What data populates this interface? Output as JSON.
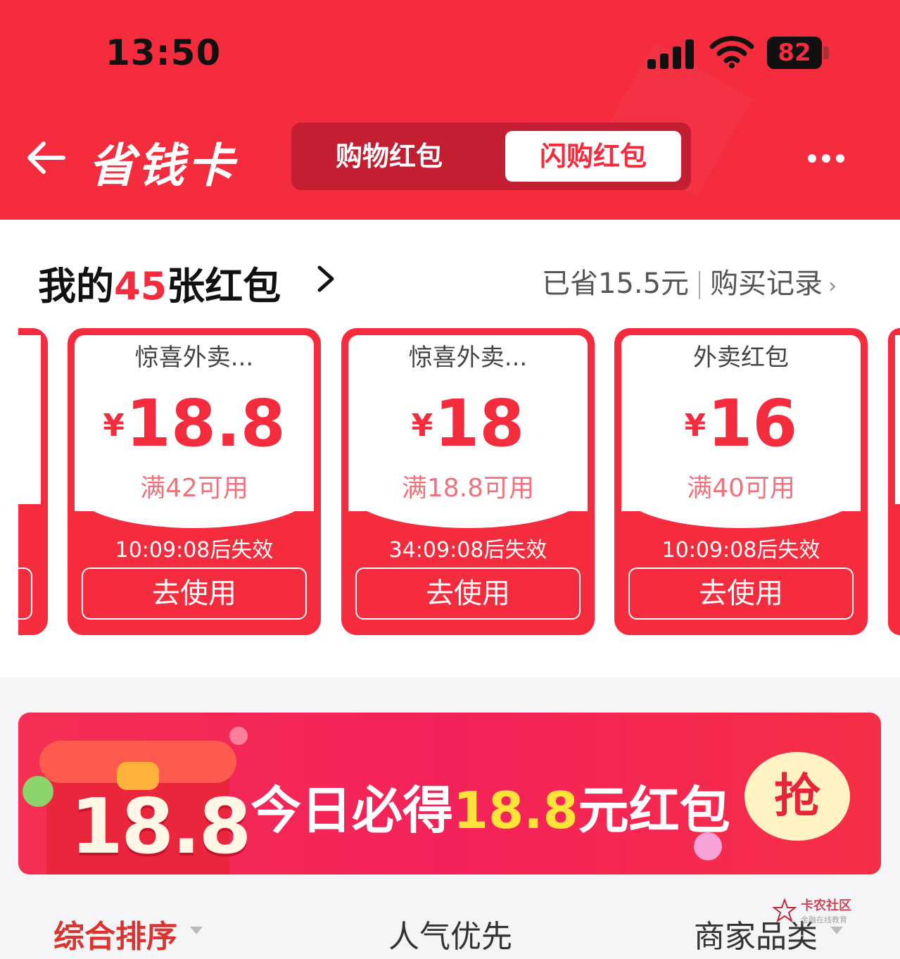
{
  "status_bar": {
    "time": "13:50",
    "battery": "82"
  },
  "header": {
    "title": "省钱卡",
    "tabs": [
      {
        "label": "购物红包",
        "active": false
      },
      {
        "label": "闪购红包",
        "active": true
      }
    ]
  },
  "summary": {
    "prefix": "我的",
    "count": "45",
    "suffix": "张红包",
    "saved": "已省15.5元",
    "history": "购买记录"
  },
  "coupons": [
    {
      "name": "惊喜外卖...",
      "currency": "¥",
      "amount": "18.8",
      "condition": "满42可用",
      "expire": "10:09:08后失效",
      "button": "去使用"
    },
    {
      "name": "惊喜外卖...",
      "currency": "¥",
      "amount": "18",
      "condition": "满18.8可用",
      "expire": "34:09:08后失效",
      "button": "去使用"
    },
    {
      "name": "外卖红包",
      "currency": "¥",
      "amount": "16",
      "condition": "满40可用",
      "expire": "10:09:08后失效",
      "button": "去使用"
    }
  ],
  "banner": {
    "big_number": "18.8",
    "text_before": "今日必得",
    "highlight": "18.8",
    "text_after": "元红包",
    "button": "抢"
  },
  "sort_tabs": [
    {
      "label": "综合排序",
      "active": true
    },
    {
      "label": "人气优先",
      "active": false
    },
    {
      "label": "商家品类",
      "active": false
    }
  ],
  "watermark": {
    "title": "卡农社区",
    "subtitle": "金融在线教育"
  },
  "colors": {
    "brand_red": "#f42c3d",
    "banner_yellow": "#ffe33a"
  }
}
